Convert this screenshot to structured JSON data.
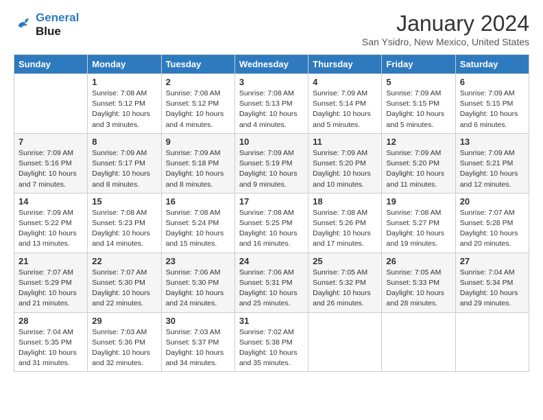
{
  "logo": {
    "line1": "General",
    "line2": "Blue"
  },
  "title": "January 2024",
  "location": "San Ysidro, New Mexico, United States",
  "days_header": [
    "Sunday",
    "Monday",
    "Tuesday",
    "Wednesday",
    "Thursday",
    "Friday",
    "Saturday"
  ],
  "weeks": [
    [
      {
        "num": "",
        "info": ""
      },
      {
        "num": "1",
        "info": "Sunrise: 7:08 AM\nSunset: 5:12 PM\nDaylight: 10 hours\nand 3 minutes."
      },
      {
        "num": "2",
        "info": "Sunrise: 7:08 AM\nSunset: 5:12 PM\nDaylight: 10 hours\nand 4 minutes."
      },
      {
        "num": "3",
        "info": "Sunrise: 7:08 AM\nSunset: 5:13 PM\nDaylight: 10 hours\nand 4 minutes."
      },
      {
        "num": "4",
        "info": "Sunrise: 7:09 AM\nSunset: 5:14 PM\nDaylight: 10 hours\nand 5 minutes."
      },
      {
        "num": "5",
        "info": "Sunrise: 7:09 AM\nSunset: 5:15 PM\nDaylight: 10 hours\nand 5 minutes."
      },
      {
        "num": "6",
        "info": "Sunrise: 7:09 AM\nSunset: 5:15 PM\nDaylight: 10 hours\nand 6 minutes."
      }
    ],
    [
      {
        "num": "7",
        "info": "Sunrise: 7:09 AM\nSunset: 5:16 PM\nDaylight: 10 hours\nand 7 minutes."
      },
      {
        "num": "8",
        "info": "Sunrise: 7:09 AM\nSunset: 5:17 PM\nDaylight: 10 hours\nand 8 minutes."
      },
      {
        "num": "9",
        "info": "Sunrise: 7:09 AM\nSunset: 5:18 PM\nDaylight: 10 hours\nand 8 minutes."
      },
      {
        "num": "10",
        "info": "Sunrise: 7:09 AM\nSunset: 5:19 PM\nDaylight: 10 hours\nand 9 minutes."
      },
      {
        "num": "11",
        "info": "Sunrise: 7:09 AM\nSunset: 5:20 PM\nDaylight: 10 hours\nand 10 minutes."
      },
      {
        "num": "12",
        "info": "Sunrise: 7:09 AM\nSunset: 5:20 PM\nDaylight: 10 hours\nand 11 minutes."
      },
      {
        "num": "13",
        "info": "Sunrise: 7:09 AM\nSunset: 5:21 PM\nDaylight: 10 hours\nand 12 minutes."
      }
    ],
    [
      {
        "num": "14",
        "info": "Sunrise: 7:09 AM\nSunset: 5:22 PM\nDaylight: 10 hours\nand 13 minutes."
      },
      {
        "num": "15",
        "info": "Sunrise: 7:08 AM\nSunset: 5:23 PM\nDaylight: 10 hours\nand 14 minutes."
      },
      {
        "num": "16",
        "info": "Sunrise: 7:08 AM\nSunset: 5:24 PM\nDaylight: 10 hours\nand 15 minutes."
      },
      {
        "num": "17",
        "info": "Sunrise: 7:08 AM\nSunset: 5:25 PM\nDaylight: 10 hours\nand 16 minutes."
      },
      {
        "num": "18",
        "info": "Sunrise: 7:08 AM\nSunset: 5:26 PM\nDaylight: 10 hours\nand 17 minutes."
      },
      {
        "num": "19",
        "info": "Sunrise: 7:08 AM\nSunset: 5:27 PM\nDaylight: 10 hours\nand 19 minutes."
      },
      {
        "num": "20",
        "info": "Sunrise: 7:07 AM\nSunset: 5:28 PM\nDaylight: 10 hours\nand 20 minutes."
      }
    ],
    [
      {
        "num": "21",
        "info": "Sunrise: 7:07 AM\nSunset: 5:29 PM\nDaylight: 10 hours\nand 21 minutes."
      },
      {
        "num": "22",
        "info": "Sunrise: 7:07 AM\nSunset: 5:30 PM\nDaylight: 10 hours\nand 22 minutes."
      },
      {
        "num": "23",
        "info": "Sunrise: 7:06 AM\nSunset: 5:30 PM\nDaylight: 10 hours\nand 24 minutes."
      },
      {
        "num": "24",
        "info": "Sunrise: 7:06 AM\nSunset: 5:31 PM\nDaylight: 10 hours\nand 25 minutes."
      },
      {
        "num": "25",
        "info": "Sunrise: 7:05 AM\nSunset: 5:32 PM\nDaylight: 10 hours\nand 26 minutes."
      },
      {
        "num": "26",
        "info": "Sunrise: 7:05 AM\nSunset: 5:33 PM\nDaylight: 10 hours\nand 28 minutes."
      },
      {
        "num": "27",
        "info": "Sunrise: 7:04 AM\nSunset: 5:34 PM\nDaylight: 10 hours\nand 29 minutes."
      }
    ],
    [
      {
        "num": "28",
        "info": "Sunrise: 7:04 AM\nSunset: 5:35 PM\nDaylight: 10 hours\nand 31 minutes."
      },
      {
        "num": "29",
        "info": "Sunrise: 7:03 AM\nSunset: 5:36 PM\nDaylight: 10 hours\nand 32 minutes."
      },
      {
        "num": "30",
        "info": "Sunrise: 7:03 AM\nSunset: 5:37 PM\nDaylight: 10 hours\nand 34 minutes."
      },
      {
        "num": "31",
        "info": "Sunrise: 7:02 AM\nSunset: 5:38 PM\nDaylight: 10 hours\nand 35 minutes."
      },
      {
        "num": "",
        "info": ""
      },
      {
        "num": "",
        "info": ""
      },
      {
        "num": "",
        "info": ""
      }
    ]
  ]
}
